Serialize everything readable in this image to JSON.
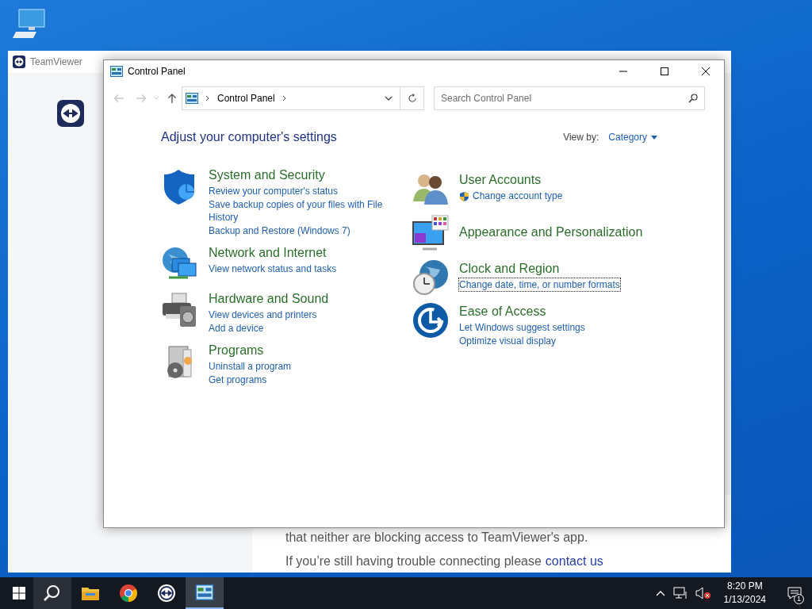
{
  "teamviewer": {
    "title": "TeamViewer",
    "paragraphs": [
      {
        "text": "that neither are blocking access to TeamViewer's app."
      },
      {
        "text": "If you’re still having trouble connecting please",
        "link": "contact us"
      }
    ]
  },
  "control_panel": {
    "title": "Control Panel",
    "address": {
      "path": "Control Panel"
    },
    "search": {
      "placeholder": "Search Control Panel"
    },
    "heading": "Adjust your computer's settings",
    "view_by": {
      "label": "View by:",
      "value": "Category"
    },
    "columns": [
      [
        {
          "kind": "security",
          "title": "System and Security",
          "links": [
            {
              "text": "Review your computer's status",
              "focused": false
            },
            {
              "text": "Save backup copies of your files with File History",
              "focused": false
            },
            {
              "text": "Backup and Restore (Windows 7)",
              "focused": false
            }
          ]
        },
        {
          "kind": "network",
          "title": "Network and Internet",
          "links": [
            {
              "text": "View network status and tasks",
              "focused": false
            }
          ]
        },
        {
          "kind": "hardware",
          "title": "Hardware and Sound",
          "links": [
            {
              "text": "View devices and printers",
              "focused": false
            },
            {
              "text": "Add a device",
              "focused": false
            }
          ]
        },
        {
          "kind": "programs",
          "title": "Programs",
          "links": [
            {
              "text": "Uninstall a program",
              "focused": false
            },
            {
              "text": "Get programs",
              "focused": false
            }
          ]
        }
      ],
      [
        {
          "kind": "users",
          "title": "User Accounts",
          "links": [
            {
              "text": "Change account type",
              "focused": false,
              "shield": true
            }
          ]
        },
        {
          "kind": "appearance",
          "title": "Appearance and Personalization"
        },
        {
          "kind": "clock",
          "title": "Clock and Region",
          "links": [
            {
              "text": "Change date, time, or number formats",
              "focused": true
            }
          ]
        },
        {
          "kind": "access",
          "title": "Ease of Access",
          "links": [
            {
              "text": "Let Windows suggest settings",
              "focused": false
            },
            {
              "text": "Optimize visual display",
              "focused": false
            }
          ]
        }
      ]
    ]
  },
  "taskbar": {
    "apps": [
      {
        "kind": "search",
        "selected": false
      },
      {
        "kind": "explorer",
        "selected": false
      },
      {
        "kind": "chrome",
        "selected": false
      },
      {
        "kind": "teamviewer",
        "selected": false
      },
      {
        "kind": "control",
        "selected": true
      }
    ],
    "time": "8:20 PM",
    "date": "1/13/2024",
    "notifications": "1"
  }
}
